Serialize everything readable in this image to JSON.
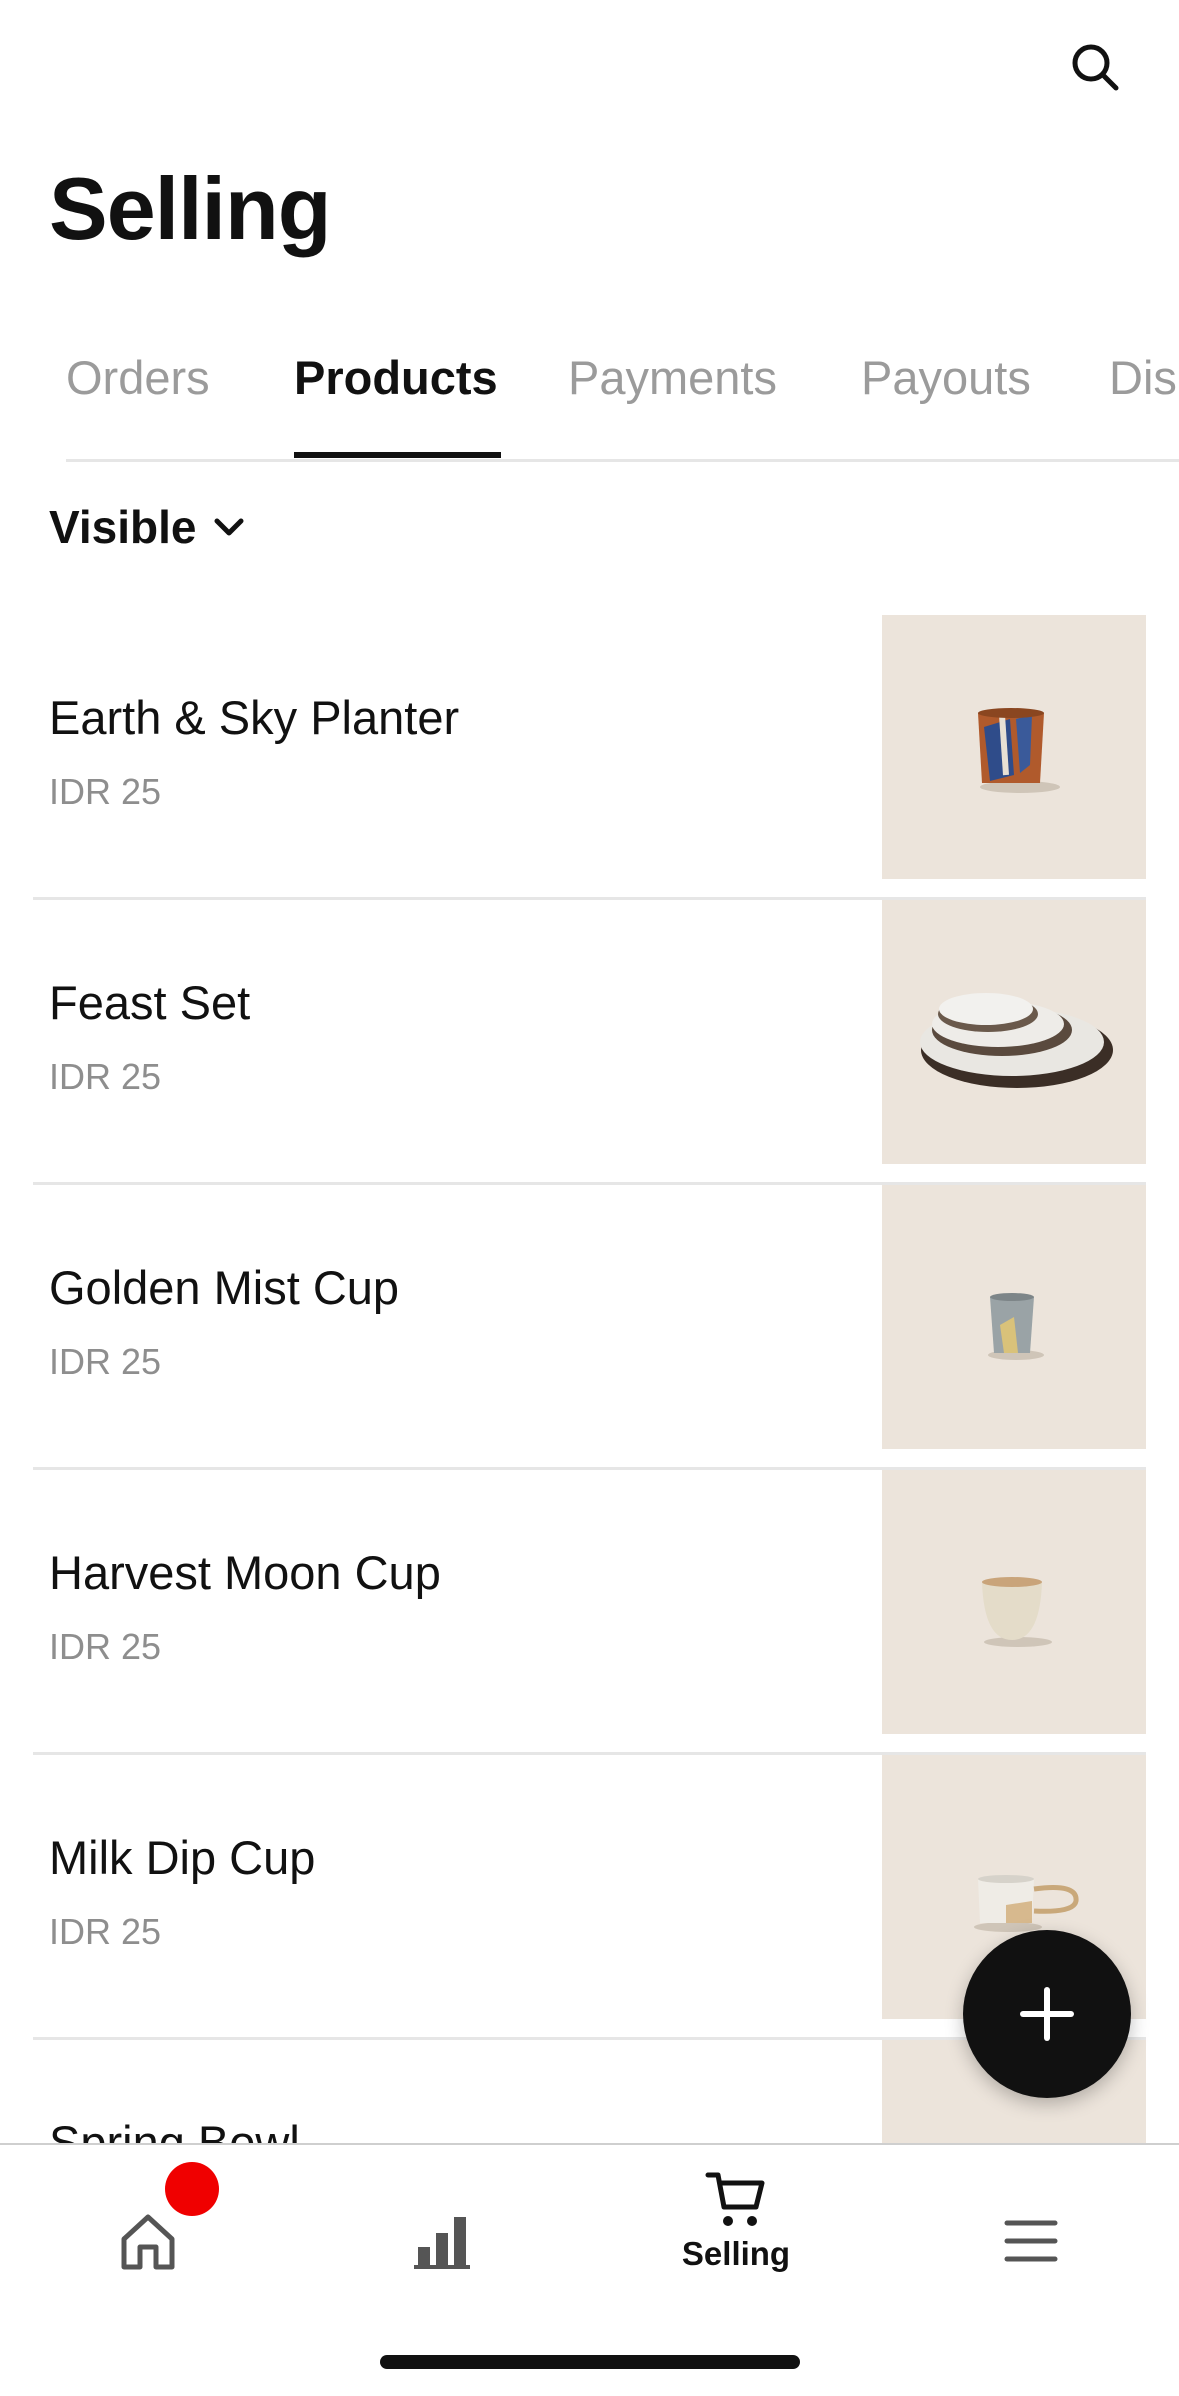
{
  "header": {
    "title": "Selling",
    "search_icon": "search-icon"
  },
  "tabs": [
    {
      "label": "Orders",
      "active": false
    },
    {
      "label": "Products",
      "active": true
    },
    {
      "label": "Payments",
      "active": false
    },
    {
      "label": "Payouts",
      "active": false
    },
    {
      "label": "Dis",
      "active": false
    }
  ],
  "filter": {
    "label": "Visible",
    "icon": "chevron-down-icon"
  },
  "products": [
    {
      "name": "Earth & Sky Planter",
      "price": "IDR 25",
      "thumb_icon": "planter-image"
    },
    {
      "name": "Feast Set",
      "price": "IDR 25",
      "thumb_icon": "plates-image"
    },
    {
      "name": "Golden Mist Cup",
      "price": "IDR 25",
      "thumb_icon": "cup-image"
    },
    {
      "name": "Harvest Moon Cup",
      "price": "IDR 25",
      "thumb_icon": "cup-image"
    },
    {
      "name": "Milk Dip Cup",
      "price": "IDR 25",
      "thumb_icon": "mug-image"
    },
    {
      "name": "Spring Bowl",
      "price": "",
      "thumb_icon": "bowl-image"
    }
  ],
  "fab": {
    "icon": "plus-icon"
  },
  "bottom_nav": {
    "items": [
      {
        "icon": "home-icon",
        "label": "",
        "badge": true
      },
      {
        "icon": "analytics-icon",
        "label": ""
      },
      {
        "icon": "cart-icon",
        "label": "Selling"
      },
      {
        "icon": "menu-icon",
        "label": ""
      }
    ]
  },
  "colors": {
    "accent": "#111111",
    "badge": "#f00000",
    "thumb_bg": "#ece4db",
    "muted_text": "#9b9b9b"
  }
}
